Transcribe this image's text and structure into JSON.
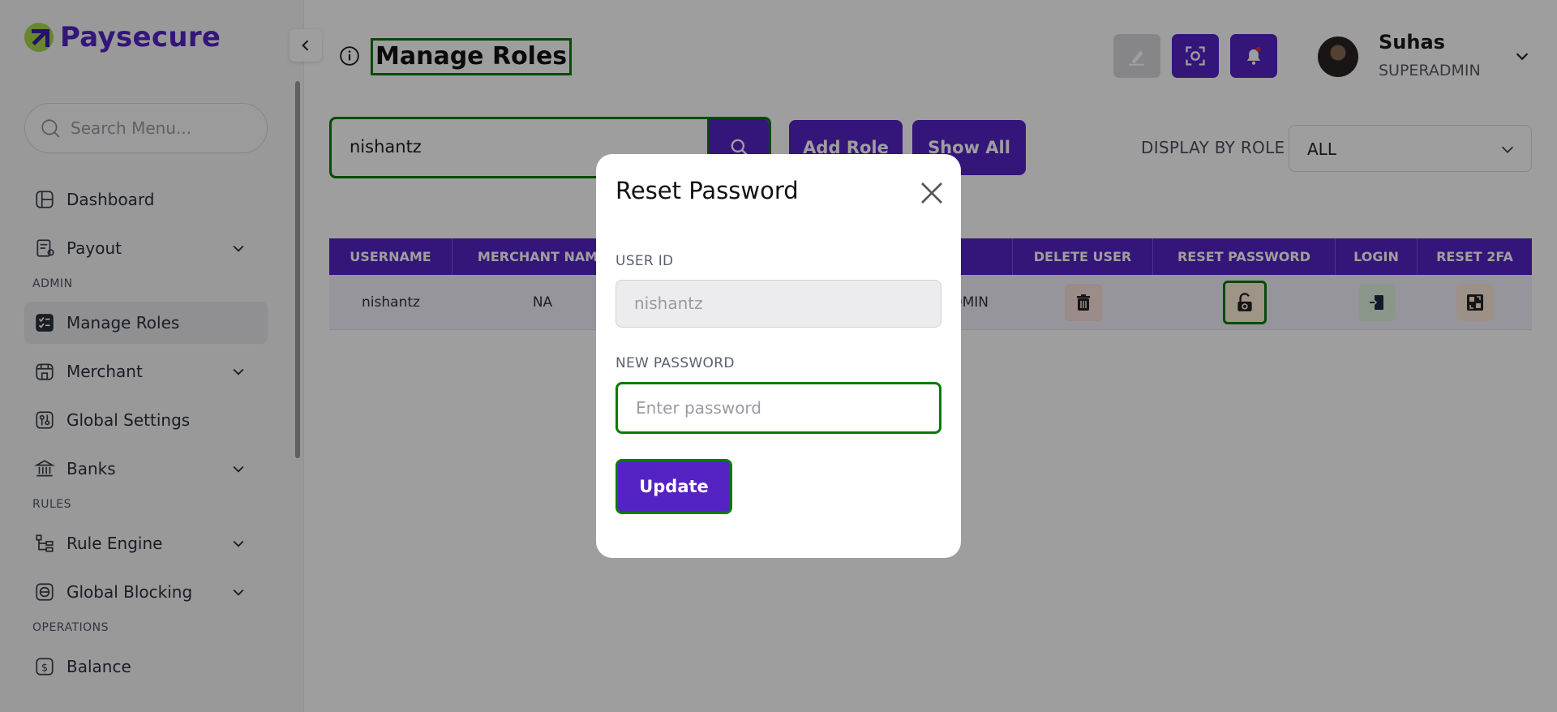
{
  "brand": {
    "name": "Paysecure",
    "logo_color": "#5523c4",
    "accent": "#a7d84a"
  },
  "sidebar": {
    "search_placeholder": "Search Menu...",
    "items": [
      {
        "label": "Dashboard",
        "icon": "dashboard-icon"
      },
      {
        "label": "Payout",
        "icon": "payout-icon",
        "expandable": true
      }
    ],
    "admin_section": "ADMIN",
    "admin_items": [
      {
        "label": "Manage Roles",
        "icon": "manage-roles-icon",
        "active": true
      },
      {
        "label": "Merchant",
        "icon": "merchant-icon",
        "expandable": true
      },
      {
        "label": "Global Settings",
        "icon": "settings-icon"
      },
      {
        "label": "Banks",
        "icon": "bank-icon",
        "expandable": true
      }
    ],
    "rules_section": "RULES",
    "rules_items": [
      {
        "label": "Rule Engine",
        "icon": "rule-engine-icon",
        "expandable": true
      },
      {
        "label": "Global Blocking",
        "icon": "global-blocking-icon",
        "expandable": true
      }
    ],
    "operations_section": "OPERATIONS",
    "operations_items": [
      {
        "label": "Balance",
        "icon": "balance-icon"
      }
    ]
  },
  "header": {
    "title": "Manage Roles",
    "user": {
      "name": "Suhas",
      "role": "SUPERADMIN"
    }
  },
  "toolbar": {
    "search_value": "nishantz",
    "add_role_label": "Add Role",
    "show_all_label": "Show All",
    "display_by_role_label": "DISPLAY BY ROLE",
    "role_filter_value": "ALL"
  },
  "table": {
    "headers": {
      "username": "USERNAME",
      "merchant": "MERCHANT NAME",
      "role": "",
      "delete": "DELETE USER",
      "reset_password": "RESET PASSWORD",
      "login": "LOGIN",
      "reset_2fa": "RESET 2FA"
    },
    "rows": [
      {
        "username": "nishantz",
        "merchant": "NA",
        "role": "ADMIN"
      }
    ]
  },
  "modal": {
    "title": "Reset Password",
    "user_id_label": "USER ID",
    "user_id_value": "nishantz",
    "new_password_label": "NEW PASSWORD",
    "new_password_placeholder": "Enter password",
    "update_label": "Update"
  },
  "colors": {
    "primary": "#5523c4",
    "focus_outline": "#0a7a0a",
    "delete_bg": "#fbe1dd",
    "reset_bg": "#fff1d8",
    "login_bg": "#dff5e2",
    "reset2fa_bg": "#fde8d9"
  }
}
